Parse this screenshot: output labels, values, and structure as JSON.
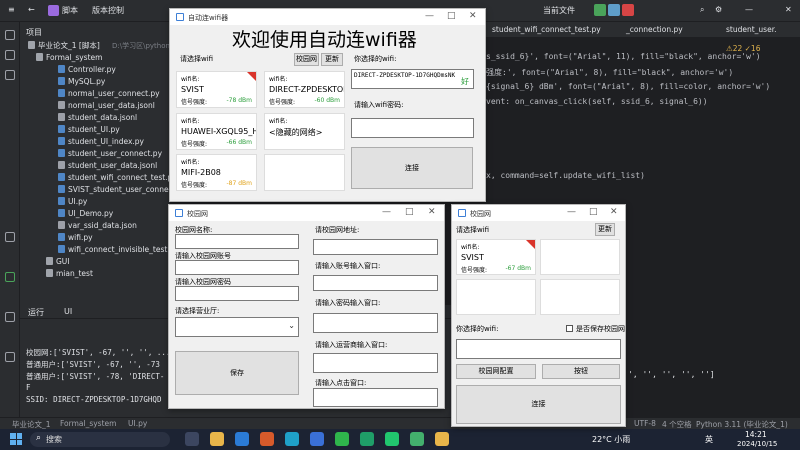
{
  "ide": {
    "menu_script": "脚本",
    "menu_version": "版本控制",
    "current_file": "当前文件",
    "tree_header": "项目",
    "tree": [
      "毕业论文_1 [脚本]",
      "Formal_system",
      "Controller.py",
      "MySQL.py",
      "normal_user_connect.py",
      "normal_user_data.jsonl",
      "student_data.jsonl",
      "student_UI.py",
      "student_UI_index.py",
      "student_user_connect.py",
      "student_user_data.jsonl",
      "student_wifi_connect_test.py",
      "SVIST_student_user_connect.py",
      "UI.py",
      "UI_Demo.py",
      "var_ssid_data.json",
      "wifi.py",
      "wifi_connect_invisible_test.py",
      "GUI",
      "mian_test"
    ],
    "tree_path": "D:\\学习区\\python",
    "tabs": [
      "student_wifi_connect_test.py",
      "_connection.py",
      "student_user."
    ],
    "code": [
      "s_ssid_6}', font=(\"Arial\", 11), fill=\"black\", anchor='w')",
      "强度:', font=(\"Arial\", 8), fill=\"black\", anchor='w')",
      "{signal_6} dBm', font=(\"Arial\", 8), fill=color, anchor='w')",
      "vent: on_canvas_click(self, ssid_6, signal_6))",
      "x, command=self.update_wifi_list)"
    ],
    "code_right": "', '', '', '', '']",
    "run_tab": "运行",
    "run_file": "UI",
    "run_lines": [
      "校园网:['SVIST', -67, '', '', ...",
      "普通用户:['SVIST', -67, '', -73",
      "普通用户:['SVIST', -78, 'DIRECT-",
      "F",
      "SSID: DIRECT-ZPDESKTOP-1D7GHQD"
    ],
    "status_path": [
      "毕业论文_1",
      "Formal_system",
      "UI.py"
    ],
    "status_right": [
      "UTF-8",
      "4 个空格",
      "Python 3.11 (毕业论文_1)"
    ],
    "warn": "⚠22 ✓16"
  },
  "win_main": {
    "title": "自动连wifi器",
    "heading": "欢迎使用自动连wifi器",
    "select_label": "请选择wifi",
    "btn_campus": "校园网",
    "btn_refresh": "更新",
    "selected_label": "你选择的wifi:",
    "selected_value": "DIRECT-ZPDESKTOP-1D7GHQDmsNK",
    "quality": "好",
    "password_label": "请输入wifi密码:",
    "connect": "连接",
    "cards": [
      {
        "name_label": "wifi名:",
        "ssid": "SVIST",
        "sig_label": "信号强度:",
        "dbm": "-78 dBm",
        "color": "#2a9d3a"
      },
      {
        "name_label": "wifi名:",
        "ssid": "DIRECT-ZPDESKTOP",
        "sig_label": "信号强度:",
        "dbm": "-60 dBm",
        "color": "#2a9d3a"
      },
      {
        "name_label": "wifi名:",
        "ssid": "HUAWEI-XGQL95_HiL",
        "sig_label": "信号强度:",
        "dbm": "-66 dBm",
        "color": "#2a9d3a"
      },
      {
        "name_label": "wifi名:",
        "ssid": "<隐藏的网络>",
        "sig_label": "",
        "dbm": "",
        "color": "#2a9d3a"
      },
      {
        "name_label": "wifi名:",
        "ssid": "MIFI-2B08",
        "sig_label": "信号强度:",
        "dbm": "-87 dBm",
        "color": "#e0a21a"
      }
    ]
  },
  "win_campus": {
    "title": "校园网",
    "l1": "校园网名称:",
    "l2": "请输入校园网账号",
    "l3": "请输入校园网密码",
    "l4": "请选择营业厅:",
    "save": "保存",
    "r1": "请校园网地址:",
    "r2": "请输入账号输入窗口:",
    "r3": "请输入密码输入窗口:",
    "r4": "请输入运营商输入窗口:",
    "r5": "请输入点击窗口:"
  },
  "win_small": {
    "title": "校园网",
    "select_label": "请选择wifi",
    "refresh": "更新",
    "card_name_label": "wifi名:",
    "card_ssid": "SVIST",
    "card_sig_label": "信号强度:",
    "card_dbm": "-67 dBm",
    "selected_label": "你选择的wifi:",
    "remember": "是否保存校园网",
    "btn_config": "校园网配置",
    "btn_break": "按钮",
    "connect": "连接"
  },
  "taskbar": {
    "search": "搜索",
    "weather": "22°C 小雨",
    "lang": "英",
    "time": "14:21",
    "date": "2024/10/15"
  }
}
